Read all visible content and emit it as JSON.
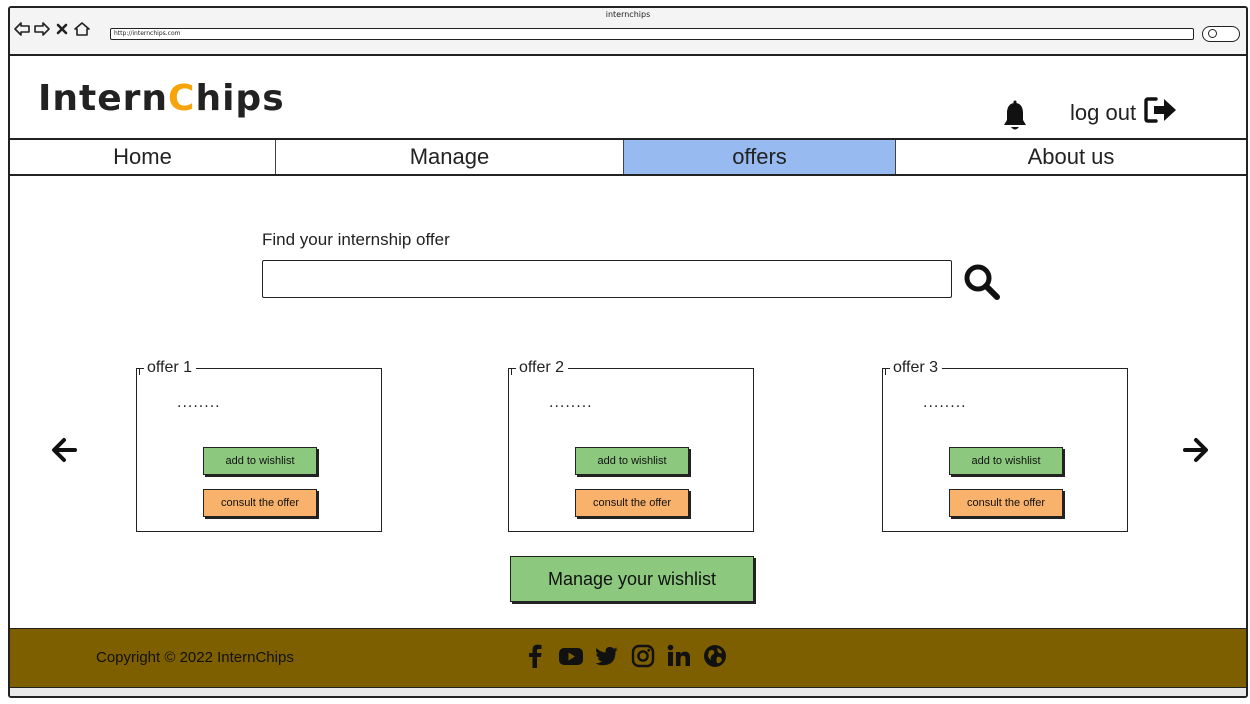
{
  "browser": {
    "title": "internchips",
    "url": "http://internchips.com"
  },
  "header": {
    "logo_part1": "Intern",
    "logo_accent": "C",
    "logo_part2": "hips",
    "logout_label": "log out"
  },
  "tabs": [
    {
      "label": "Home",
      "active": false
    },
    {
      "label": "Manage",
      "active": false
    },
    {
      "label": "offers",
      "active": true
    },
    {
      "label": "About us",
      "active": false
    }
  ],
  "search": {
    "label": "Find your internship offer",
    "value": "",
    "placeholder": ""
  },
  "offers": [
    {
      "legend": "offer 1",
      "content": "........",
      "wishlist_label": "add to wishlist",
      "consult_label": "consult the offer"
    },
    {
      "legend": "offer 2",
      "content": "........",
      "wishlist_label": "add to wishlist",
      "consult_label": "consult the offer"
    },
    {
      "legend": "offer 3",
      "content": "........",
      "wishlist_label": "add to wishlist",
      "consult_label": "consult the offer"
    }
  ],
  "manage_wishlist_label": "Manage your wishlist",
  "footer": {
    "copyright": "Copyright © 2022 InternChips",
    "social": [
      "facebook-icon",
      "youtube-icon",
      "twitter-icon",
      "instagram-icon",
      "linkedin-icon",
      "globe-icon"
    ]
  },
  "colors": {
    "active_tab": "#97baf0",
    "logo_accent": "#f7a30a",
    "wishlist_button": "#8cc97f",
    "consult_button": "#f9b26b",
    "footer": "#7e5f00"
  }
}
